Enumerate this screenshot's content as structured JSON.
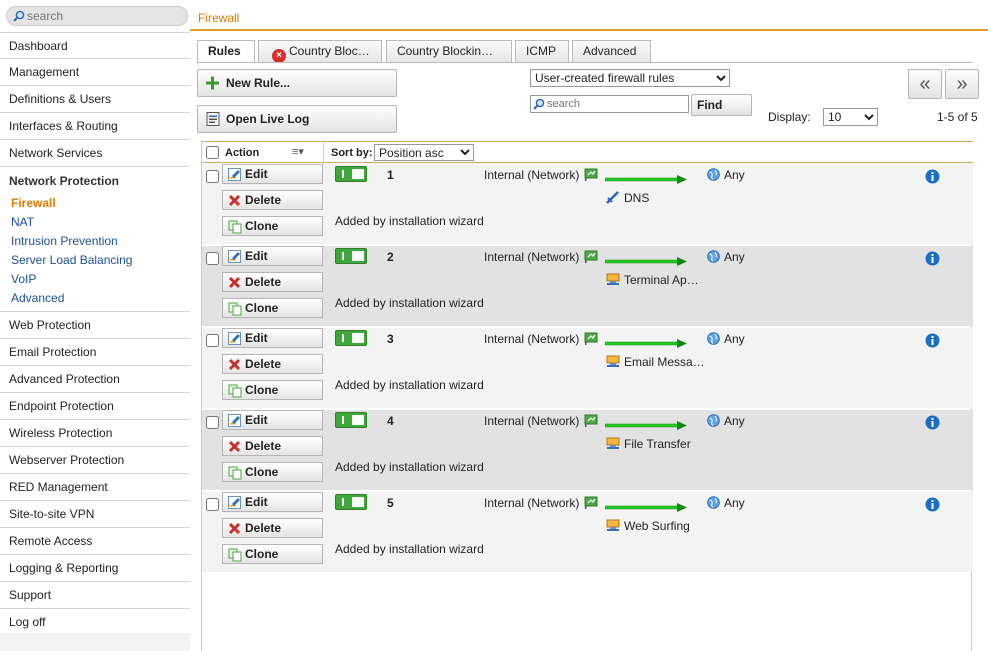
{
  "search": {
    "placeholder": "search"
  },
  "sidebar": {
    "items_top": [
      "Dashboard",
      "Management",
      "Definitions & Users",
      "Interfaces & Routing",
      "Network Services"
    ],
    "group": {
      "title": "Network Protection",
      "items": [
        "Firewall",
        "NAT",
        "Intrusion Prevention",
        "Server Load Balancing",
        "VoIP",
        "Advanced"
      ],
      "active": "Firewall"
    },
    "items_bottom": [
      "Web Protection",
      "Email Protection",
      "Advanced Protection",
      "Endpoint Protection",
      "Wireless Protection",
      "Webserver Protection",
      "RED Management",
      "Site-to-site VPN",
      "Remote Access",
      "Logging & Reporting",
      "Support",
      "Log off"
    ]
  },
  "header": {
    "title": "Firewall"
  },
  "tabs": [
    {
      "label": "Rules",
      "active": true
    },
    {
      "label": "Country Bloc…",
      "error": true
    },
    {
      "label": "Country Blockin…"
    },
    {
      "label": "ICMP"
    },
    {
      "label": "Advanced"
    }
  ],
  "toolbar": {
    "new_rule": "New Rule...",
    "open_live_log": "Open Live Log",
    "filter_value": "User-created firewall rules",
    "search_placeholder": "search",
    "find": "Find",
    "display_label": "Display:",
    "display_value": "10",
    "pager_prev": "«",
    "pager_next": "»",
    "pager_count": "1-5 of 5"
  },
  "table_header": {
    "action": "Action",
    "sort_by": "Sort by:",
    "sort_value": "Position asc"
  },
  "row_buttons": {
    "edit": "Edit",
    "delete": "Delete",
    "clone": "Clone"
  },
  "rules": [
    {
      "position": "1",
      "source": "Internal (Network)",
      "service": "DNS",
      "service_icon": "dns-icon",
      "destination": "Any",
      "comment": "Added by installation wizard"
    },
    {
      "position": "2",
      "source": "Internal (Network)",
      "service": "Terminal Ap…",
      "service_icon": "service-group-icon",
      "destination": "Any",
      "comment": "Added by installation wizard"
    },
    {
      "position": "3",
      "source": "Internal (Network)",
      "service": "Email Messa…",
      "service_icon": "service-group-icon",
      "destination": "Any",
      "comment": "Added by installation wizard"
    },
    {
      "position": "4",
      "source": "Internal (Network)",
      "service": "File Transfer",
      "service_icon": "service-group-icon",
      "destination": "Any",
      "comment": "Added by installation wizard"
    },
    {
      "position": "5",
      "source": "Internal (Network)",
      "service": "Web Surfing",
      "service_icon": "service-group-icon",
      "destination": "Any",
      "comment": "Added by installation wizard"
    }
  ],
  "colors": {
    "accent": "#e07b00",
    "link": "#1c4e9a",
    "toggle_on": "#3fa83b",
    "arrow": "#22cc22",
    "info": "#1a6fc4"
  }
}
